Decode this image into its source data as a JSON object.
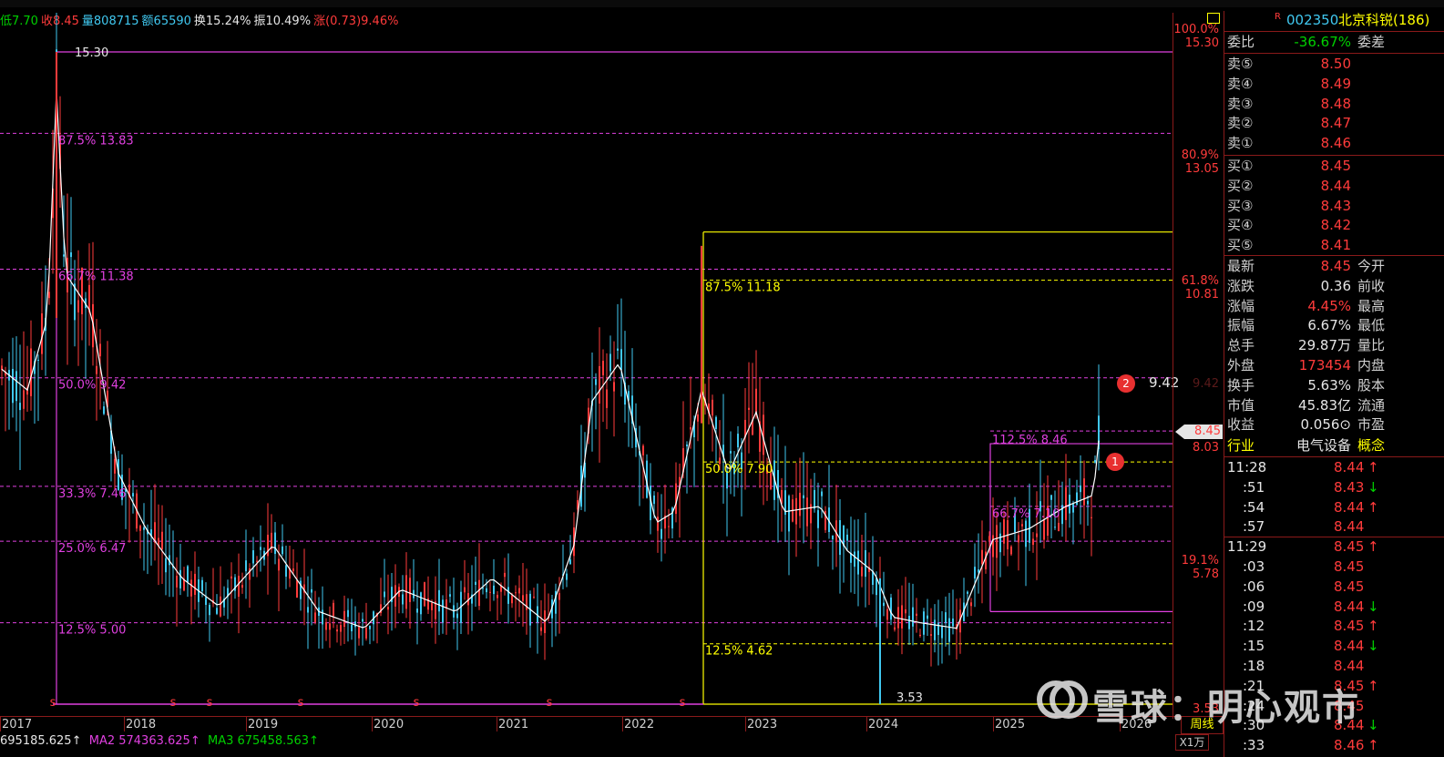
{
  "infobar": {
    "low": "低7.70",
    "close": "收8.45",
    "volume": "量808715",
    "amount": "额65590",
    "turnover": "换15.24%",
    "amplitude": "振10.49%",
    "change": "涨(0.73)9.46%"
  },
  "price_axis": [
    {
      "pct": "100.0%",
      "price": "15.30"
    },
    {
      "pct": "80.9%",
      "price": "13.05"
    },
    {
      "pct": "61.8%",
      "price": "10.81"
    },
    {
      "pct": "38.2%",
      "price": "8.03"
    },
    {
      "pct": "19.1%",
      "price": "5.78"
    },
    {
      "pct": "",
      "price": "3.53"
    }
  ],
  "current_price_tag": "8.45",
  "price_axis_942": "9.42",
  "fib_labels_magenta": [
    "15.30",
    "87.5% 13.83",
    "66.7% 11.38",
    "50.0% 9.42",
    "33.3% 7.46",
    "25.0% 6.47",
    "12.5% 5.00"
  ],
  "fib_labels_yellow": [
    "87.5% 11.18",
    "50.0% 7.90",
    "12.5% 4.62"
  ],
  "fib_labels_recent": [
    "112.5% 8.46",
    "66.7% 7.10"
  ],
  "low_label": "3.53",
  "marker1": "1",
  "marker2": "2",
  "marker2_value": "9.42",
  "years": [
    "2017",
    "2018",
    "2019",
    "2020",
    "2021",
    "2022",
    "2023",
    "2024",
    "2025",
    "2026"
  ],
  "period": "周线",
  "unit": "X1万",
  "ma": {
    "ma1": "695185.625↑",
    "ma2": "MA2 574363.625↑",
    "ma3": "MA3 675458.563↑"
  },
  "panel": {
    "r_mark": "R",
    "code": "002350",
    "name": "北京科锐(186)",
    "weibi_label": "委比",
    "weibi_value": "-36.67%",
    "weicha_label": "委差",
    "asks": [
      {
        "label": "卖⑤",
        "price": "8.50"
      },
      {
        "label": "卖④",
        "price": "8.49"
      },
      {
        "label": "卖③",
        "price": "8.48"
      },
      {
        "label": "卖②",
        "price": "8.47"
      },
      {
        "label": "卖①",
        "price": "8.46"
      }
    ],
    "bids": [
      {
        "label": "买①",
        "price": "8.45"
      },
      {
        "label": "买②",
        "price": "8.44"
      },
      {
        "label": "买③",
        "price": "8.43"
      },
      {
        "label": "买④",
        "price": "8.42"
      },
      {
        "label": "买⑤",
        "price": "8.41"
      }
    ],
    "stats": [
      {
        "k": "最新",
        "v": "8.45",
        "k2": "今开",
        "color": "#ff3b3b"
      },
      {
        "k": "涨跌",
        "v": "0.36",
        "k2": "前收",
        "color": "#e6e6e6"
      },
      {
        "k": "涨幅",
        "v": "4.45%",
        "k2": "最高",
        "color": "#ff3b3b"
      },
      {
        "k": "振幅",
        "v": "6.67%",
        "k2": "最低",
        "color": "#e6e6e6"
      },
      {
        "k": "总手",
        "v": "29.87万",
        "k2": "量比",
        "color": "#e6e6e6"
      },
      {
        "k": "外盘",
        "v": "173454",
        "k2": "内盘",
        "color": "#ff3b3b"
      },
      {
        "k": "换手",
        "v": "5.63%",
        "k2": "股本",
        "color": "#e6e6e6"
      },
      {
        "k": "市值",
        "v": "45.83亿",
        "k2": "流通",
        "color": "#e6e6e6"
      },
      {
        "k": "收益",
        "v": "0.056⊙",
        "k2": "市盈",
        "color": "#e6e6e6"
      }
    ],
    "industry_label": "行业",
    "industry_value": "电气设备",
    "concept_label": "概念",
    "ticks": [
      {
        "t": "11:28",
        "p": "8.44↑",
        "c": "#ff3b3b"
      },
      {
        "t": ":51",
        "p": "8.43↓",
        "c": "#ff3b3b",
        "ac": "#00d000"
      },
      {
        "t": ":54",
        "p": "8.44↑",
        "c": "#ff3b3b"
      },
      {
        "t": ":57",
        "p": "8.44",
        "c": "#ff3b3b"
      },
      {
        "t": "11:29",
        "p": "8.45↑",
        "c": "#ff3b3b"
      },
      {
        "t": ":03",
        "p": "8.45",
        "c": "#ff3b3b"
      },
      {
        "t": ":06",
        "p": "8.45",
        "c": "#ff3b3b"
      },
      {
        "t": ":09",
        "p": "8.44↓",
        "c": "#ff3b3b",
        "ac": "#00d000"
      },
      {
        "t": ":12",
        "p": "8.45↑",
        "c": "#ff3b3b"
      },
      {
        "t": ":15",
        "p": "8.44↓",
        "c": "#ff3b3b",
        "ac": "#00d000"
      },
      {
        "t": ":18",
        "p": "8.44",
        "c": "#ff3b3b"
      },
      {
        "t": ":21",
        "p": "8.45↑",
        "c": "#ff3b3b"
      },
      {
        "t": ":24",
        "p": "8.45",
        "c": "#ff3b3b"
      },
      {
        "t": ":30",
        "p": "8.44↓",
        "c": "#ff3b3b",
        "ac": "#00d000"
      },
      {
        "t": ":33",
        "p": "8.46↑",
        "c": "#ff3b3b"
      }
    ]
  },
  "watermark": "雪球：明心观市",
  "colors": {
    "up": "#ff3b3b",
    "down": "#40c8f0",
    "fib": "#e040e0",
    "fib2": "#ffff00",
    "ma": "#ffffff"
  },
  "chart_data": {
    "type": "candlestick-weekly",
    "price_range": [
      3.53,
      15.3
    ],
    "key_points": [
      {
        "year": "2017",
        "price": 15.3,
        "note": "peak"
      },
      {
        "year": "2021-2022",
        "price": 11.18
      },
      {
        "year": "2024",
        "price": 3.53,
        "note": "low"
      },
      {
        "year": "2025",
        "price": 8.45,
        "note": "current"
      }
    ],
    "levels_magenta": [
      15.3,
      13.83,
      11.38,
      9.42,
      7.46,
      6.47,
      5.0
    ],
    "levels_yellow": [
      11.18,
      7.9,
      4.62
    ]
  }
}
